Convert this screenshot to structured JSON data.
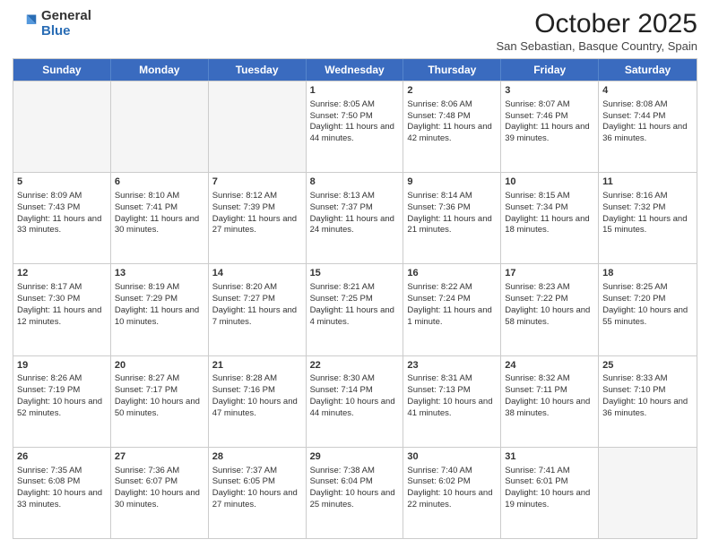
{
  "logo": {
    "general": "General",
    "blue": "Blue"
  },
  "header": {
    "month": "October 2025",
    "location": "San Sebastian, Basque Country, Spain"
  },
  "days": [
    "Sunday",
    "Monday",
    "Tuesday",
    "Wednesday",
    "Thursday",
    "Friday",
    "Saturday"
  ],
  "weeks": [
    [
      {
        "day": "",
        "info": ""
      },
      {
        "day": "",
        "info": ""
      },
      {
        "day": "",
        "info": ""
      },
      {
        "day": "1",
        "info": "Sunrise: 8:05 AM\nSunset: 7:50 PM\nDaylight: 11 hours and 44 minutes."
      },
      {
        "day": "2",
        "info": "Sunrise: 8:06 AM\nSunset: 7:48 PM\nDaylight: 11 hours and 42 minutes."
      },
      {
        "day": "3",
        "info": "Sunrise: 8:07 AM\nSunset: 7:46 PM\nDaylight: 11 hours and 39 minutes."
      },
      {
        "day": "4",
        "info": "Sunrise: 8:08 AM\nSunset: 7:44 PM\nDaylight: 11 hours and 36 minutes."
      }
    ],
    [
      {
        "day": "5",
        "info": "Sunrise: 8:09 AM\nSunset: 7:43 PM\nDaylight: 11 hours and 33 minutes."
      },
      {
        "day": "6",
        "info": "Sunrise: 8:10 AM\nSunset: 7:41 PM\nDaylight: 11 hours and 30 minutes."
      },
      {
        "day": "7",
        "info": "Sunrise: 8:12 AM\nSunset: 7:39 PM\nDaylight: 11 hours and 27 minutes."
      },
      {
        "day": "8",
        "info": "Sunrise: 8:13 AM\nSunset: 7:37 PM\nDaylight: 11 hours and 24 minutes."
      },
      {
        "day": "9",
        "info": "Sunrise: 8:14 AM\nSunset: 7:36 PM\nDaylight: 11 hours and 21 minutes."
      },
      {
        "day": "10",
        "info": "Sunrise: 8:15 AM\nSunset: 7:34 PM\nDaylight: 11 hours and 18 minutes."
      },
      {
        "day": "11",
        "info": "Sunrise: 8:16 AM\nSunset: 7:32 PM\nDaylight: 11 hours and 15 minutes."
      }
    ],
    [
      {
        "day": "12",
        "info": "Sunrise: 8:17 AM\nSunset: 7:30 PM\nDaylight: 11 hours and 12 minutes."
      },
      {
        "day": "13",
        "info": "Sunrise: 8:19 AM\nSunset: 7:29 PM\nDaylight: 11 hours and 10 minutes."
      },
      {
        "day": "14",
        "info": "Sunrise: 8:20 AM\nSunset: 7:27 PM\nDaylight: 11 hours and 7 minutes."
      },
      {
        "day": "15",
        "info": "Sunrise: 8:21 AM\nSunset: 7:25 PM\nDaylight: 11 hours and 4 minutes."
      },
      {
        "day": "16",
        "info": "Sunrise: 8:22 AM\nSunset: 7:24 PM\nDaylight: 11 hours and 1 minute."
      },
      {
        "day": "17",
        "info": "Sunrise: 8:23 AM\nSunset: 7:22 PM\nDaylight: 10 hours and 58 minutes."
      },
      {
        "day": "18",
        "info": "Sunrise: 8:25 AM\nSunset: 7:20 PM\nDaylight: 10 hours and 55 minutes."
      }
    ],
    [
      {
        "day": "19",
        "info": "Sunrise: 8:26 AM\nSunset: 7:19 PM\nDaylight: 10 hours and 52 minutes."
      },
      {
        "day": "20",
        "info": "Sunrise: 8:27 AM\nSunset: 7:17 PM\nDaylight: 10 hours and 50 minutes."
      },
      {
        "day": "21",
        "info": "Sunrise: 8:28 AM\nSunset: 7:16 PM\nDaylight: 10 hours and 47 minutes."
      },
      {
        "day": "22",
        "info": "Sunrise: 8:30 AM\nSunset: 7:14 PM\nDaylight: 10 hours and 44 minutes."
      },
      {
        "day": "23",
        "info": "Sunrise: 8:31 AM\nSunset: 7:13 PM\nDaylight: 10 hours and 41 minutes."
      },
      {
        "day": "24",
        "info": "Sunrise: 8:32 AM\nSunset: 7:11 PM\nDaylight: 10 hours and 38 minutes."
      },
      {
        "day": "25",
        "info": "Sunrise: 8:33 AM\nSunset: 7:10 PM\nDaylight: 10 hours and 36 minutes."
      }
    ],
    [
      {
        "day": "26",
        "info": "Sunrise: 7:35 AM\nSunset: 6:08 PM\nDaylight: 10 hours and 33 minutes."
      },
      {
        "day": "27",
        "info": "Sunrise: 7:36 AM\nSunset: 6:07 PM\nDaylight: 10 hours and 30 minutes."
      },
      {
        "day": "28",
        "info": "Sunrise: 7:37 AM\nSunset: 6:05 PM\nDaylight: 10 hours and 27 minutes."
      },
      {
        "day": "29",
        "info": "Sunrise: 7:38 AM\nSunset: 6:04 PM\nDaylight: 10 hours and 25 minutes."
      },
      {
        "day": "30",
        "info": "Sunrise: 7:40 AM\nSunset: 6:02 PM\nDaylight: 10 hours and 22 minutes."
      },
      {
        "day": "31",
        "info": "Sunrise: 7:41 AM\nSunset: 6:01 PM\nDaylight: 10 hours and 19 minutes."
      },
      {
        "day": "",
        "info": ""
      }
    ]
  ]
}
